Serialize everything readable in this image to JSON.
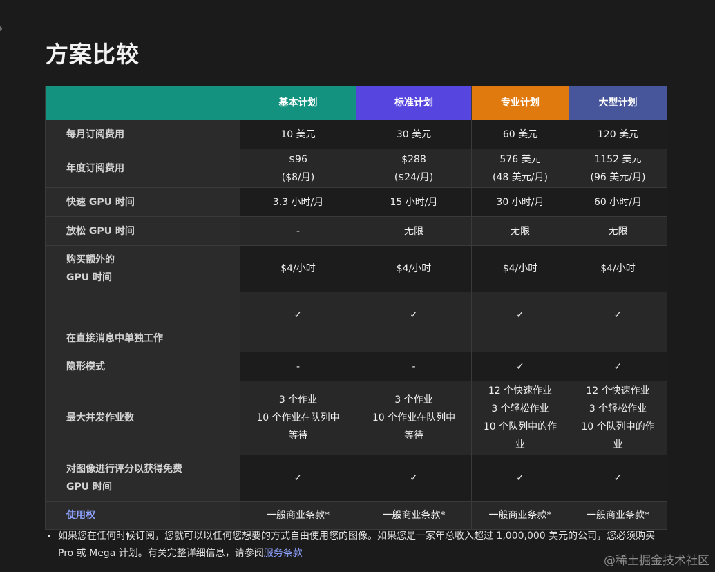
{
  "page": {
    "title": "方案比较"
  },
  "table": {
    "columns": [
      {
        "name": "基本计划",
        "color": "#12927f"
      },
      {
        "name": "标准计划",
        "color": "#5745e0"
      },
      {
        "name": "专业计划",
        "color": "#e07a0f"
      },
      {
        "name": "大型计划",
        "color": "#47569a"
      }
    ],
    "rows": {
      "monthly": {
        "label": "每月订阅费用",
        "values": [
          "10 美元",
          "30 美元",
          "60 美元",
          "120 美元"
        ]
      },
      "annual": {
        "label": "年度订阅费用",
        "values": [
          [
            "$96",
            "($8/月)"
          ],
          [
            "$288",
            "($24/月)"
          ],
          [
            "576 美元",
            "(48 美元/月)"
          ],
          [
            "1152 美元",
            "(96 美元/月)"
          ]
        ]
      },
      "fast": {
        "label": "快速 GPU 时间",
        "values": [
          "3.3 小时/月",
          "15 小时/月",
          "30 小时/月",
          "60 小时/月"
        ]
      },
      "relax": {
        "label": "放松 GPU 时间",
        "values": [
          "-",
          "无限",
          "无限",
          "无限"
        ]
      },
      "extra": {
        "label_lines": [
          "购买额外的",
          "GPU 时间"
        ],
        "values": [
          "$4/小时",
          "$4/小时",
          "$4/小时",
          "$4/小时"
        ]
      },
      "dm": {
        "label": "在直接消息中单独工作",
        "values": [
          "✓",
          "✓",
          "✓",
          "✓"
        ]
      },
      "stealth": {
        "label": "隐形模式",
        "values": [
          "-",
          "-",
          "✓",
          "✓"
        ]
      },
      "jobs": {
        "label": "最大并发作业数",
        "values": [
          [
            "3 个作业",
            "10 个作业在队列中",
            "等待"
          ],
          [
            "3 个作业",
            "10 个作业在队列中",
            "等待"
          ],
          [
            "12 个快速作业",
            "3 个轻松作业",
            "10 个队列中的作",
            "业"
          ],
          [
            "12 个快速作业",
            "3 个轻松作业",
            "10 个队列中的作",
            "业"
          ]
        ]
      },
      "rate": {
        "label_lines": [
          "对图像进行评分以获得免费",
          "GPU 时间"
        ],
        "values": [
          "✓",
          "✓",
          "✓",
          "✓"
        ]
      },
      "usage": {
        "label": "使用权",
        "values": [
          "一般商业条款*",
          "一般商业条款*",
          "一般商业条款*",
          "一般商业条款*"
        ]
      }
    }
  },
  "note": {
    "text": "如果您在任何时候订阅，您就可以以任何您想要的方式自由使用您的图像。如果您是一家年总收入超过 1,000,000 美元的公司，您必须购买 Pro 或 Mega 计划。有关完整详细信息，请参阅",
    "link_text": "服务条款"
  },
  "watermark": "@稀土掘金技术社区"
}
